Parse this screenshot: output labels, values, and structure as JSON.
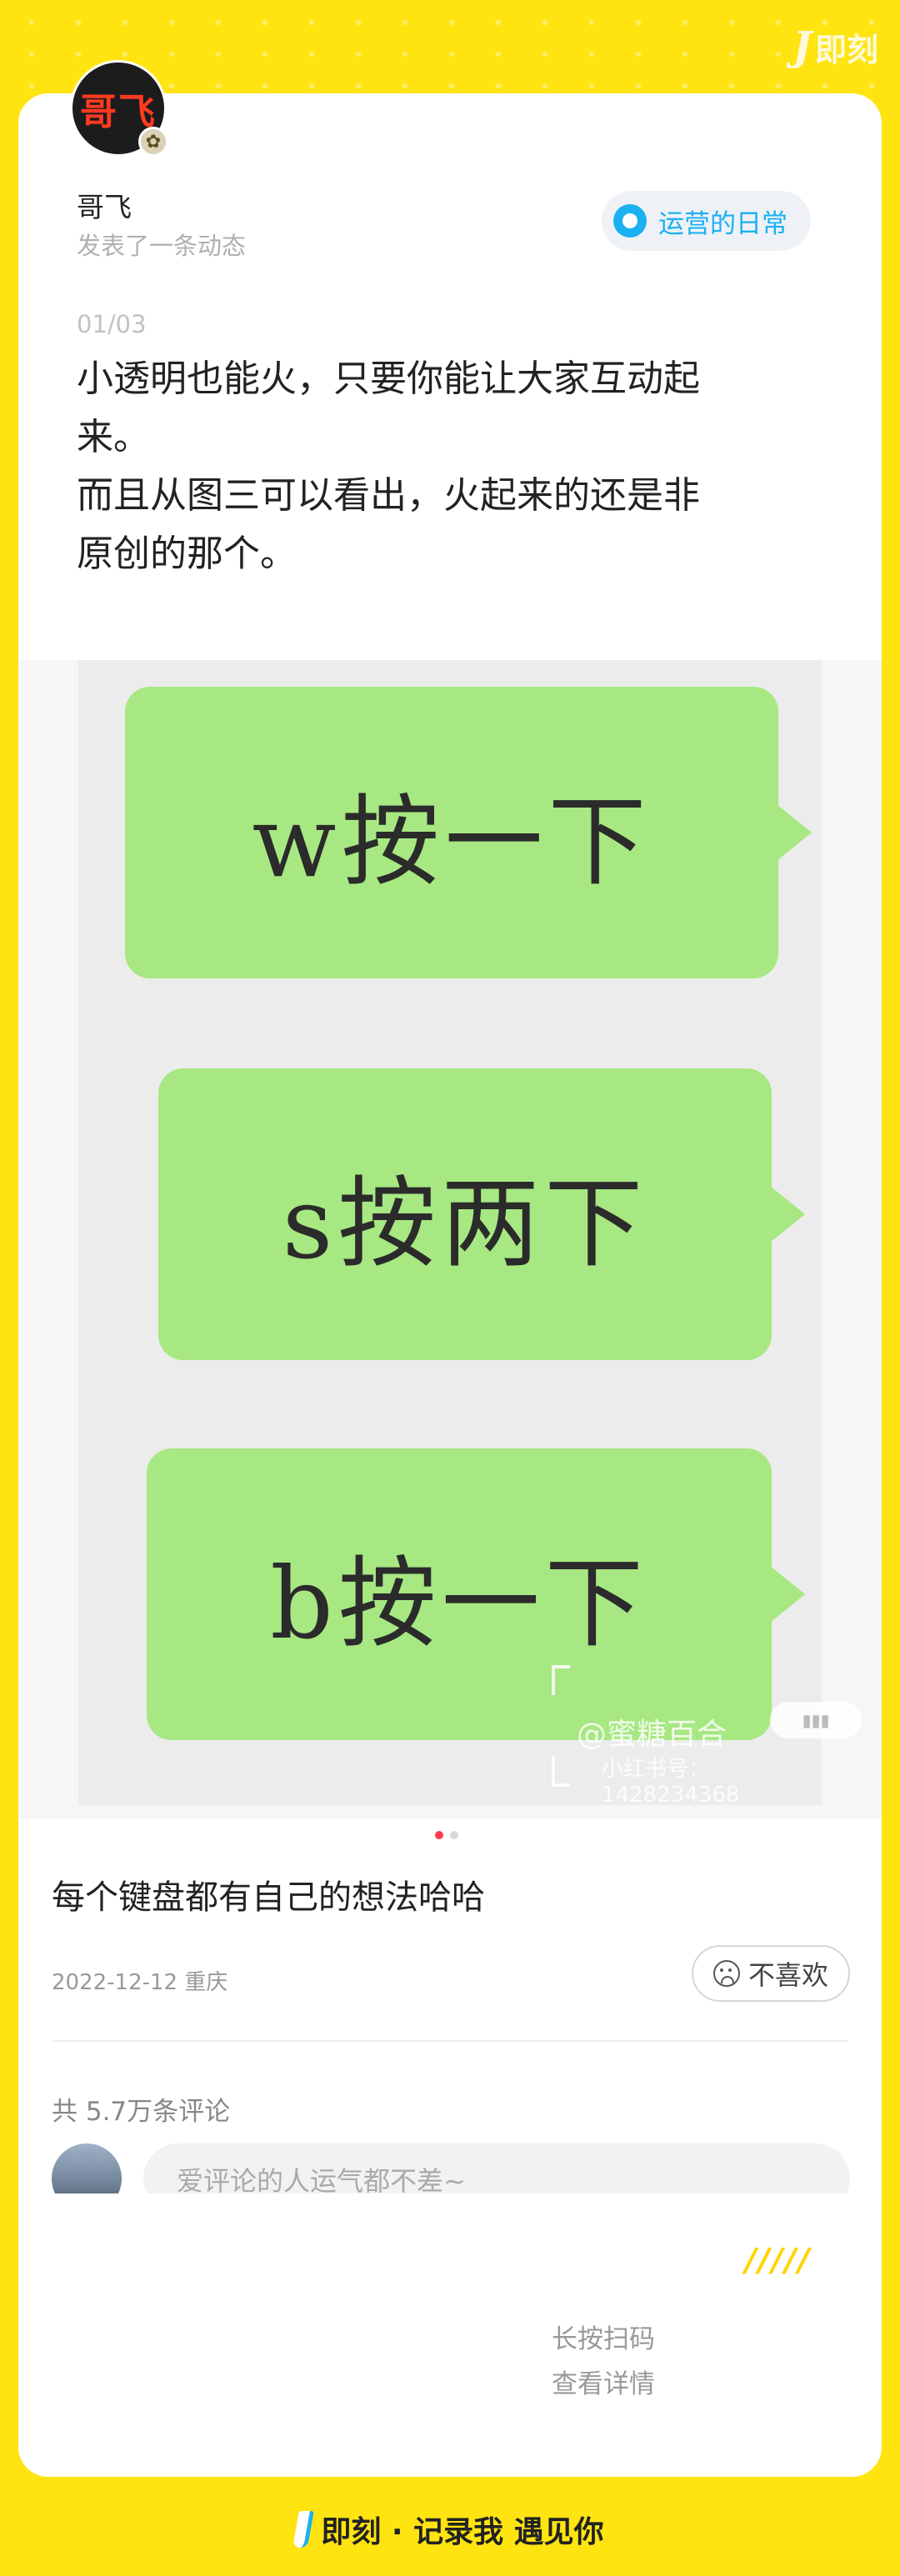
{
  "brand": {
    "top_logo_text": "即刻",
    "slogan": "即刻 · 记录我 遇见你"
  },
  "post": {
    "author": {
      "avatar_text": "哥飞",
      "name": "哥飞",
      "action": "发表了一条动态"
    },
    "topic": "运营的日常",
    "image_counter": "01/03",
    "text_lines": [
      "小透明也能火，只要你能让大家互动起",
      "来。",
      "而且从图三可以看出，火起来的还是非",
      "原创的那个。"
    ],
    "image": {
      "bubbles": [
        "w按一下",
        "s按两下",
        "b按一下"
      ],
      "watermark_name": "@蜜糖百合",
      "watermark_id": "小红书号：1428234368"
    },
    "caption": "每个键盘都有自己的想法哈哈",
    "date": "2022-12-12",
    "location": "重庆",
    "dislike_label": "不喜欢",
    "comment_count": "共 5.7万条评论",
    "comment_placeholder": "爱评论的人运气都不差~"
  },
  "qr": {
    "decoration": "/////",
    "hint_line1": "长按扫码",
    "hint_line2": "查看详情"
  },
  "pager": {
    "total": 2,
    "active": 0
  },
  "colors": {
    "background": "#FFE411",
    "accent_blue": "#1ab0f2",
    "bubble_green": "#a7e882",
    "pager_active": "#ff3b4f"
  }
}
